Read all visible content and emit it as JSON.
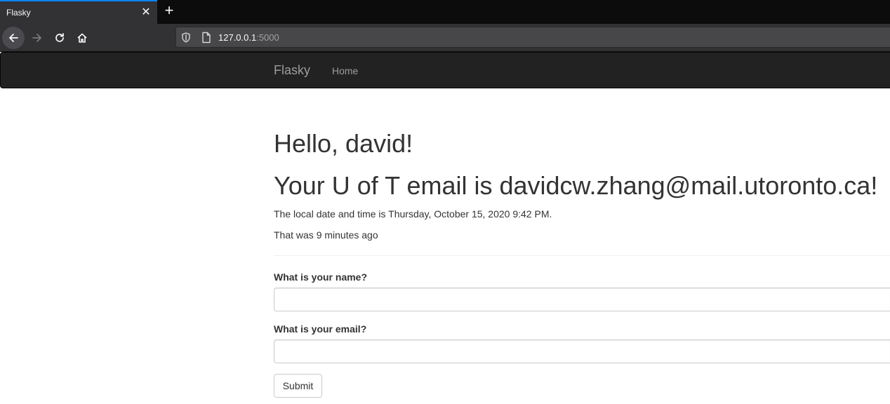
{
  "browser": {
    "tab_title": "Flasky",
    "tab_close_glyph": "✕",
    "new_tab_glyph": "+",
    "url_host": "127.0.0.1",
    "url_port": ":5000",
    "icons": [
      "back-icon",
      "forward-icon",
      "reload-icon",
      "home-icon",
      "shield-icon",
      "page-icon",
      "close-icon",
      "plus-icon"
    ],
    "accent_color": "#0a84ff"
  },
  "navbar": {
    "brand": "Flasky",
    "links": [
      {
        "label": "Home"
      }
    ],
    "background": "#222222"
  },
  "main": {
    "greeting": "Hello, david!",
    "email_heading": "Your U of T email is davidcw.zhang@mail.utoronto.ca!",
    "local_time": "The local date and time is Thursday, October 15, 2020 9:42 PM.",
    "relative_time": "That was 9 minutes ago"
  },
  "form": {
    "name_label": "What is your name?",
    "name_value": "",
    "email_label": "What is your email?",
    "email_value": "",
    "submit_label": "Submit"
  }
}
